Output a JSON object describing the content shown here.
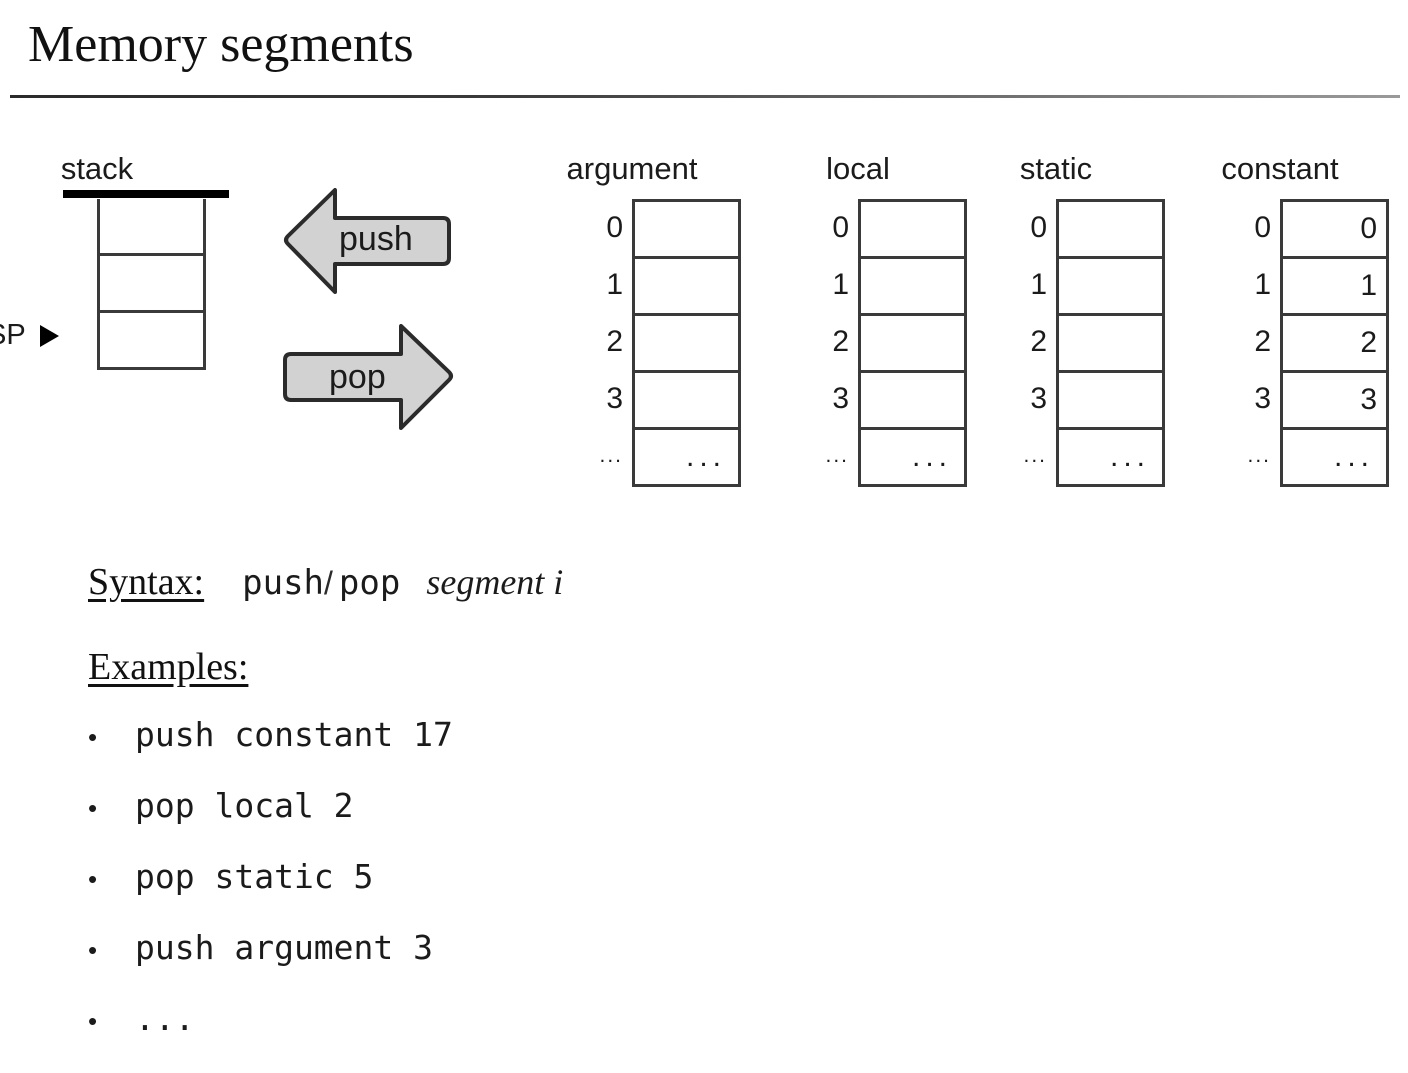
{
  "slide": {
    "title": "Memory segments"
  },
  "stack": {
    "label": "stack",
    "pointer_label": "SP",
    "pointer_icon": "right-triangle-arrow-icon",
    "pointer_at_cell": 2,
    "cells": [
      "",
      "",
      ""
    ]
  },
  "operations": [
    {
      "name": "push",
      "label": "push",
      "direction": "left",
      "icon": "left-arrow-shape-icon"
    },
    {
      "name": "pop",
      "label": "pop",
      "direction": "right",
      "icon": "right-arrow-shape-icon"
    }
  ],
  "segments": [
    {
      "name": "argument",
      "label": "argument",
      "indices": [
        "0",
        "1",
        "2",
        "3",
        "..."
      ],
      "values": [
        "",
        "",
        "",
        "",
        "..."
      ]
    },
    {
      "name": "local",
      "label": "local",
      "indices": [
        "0",
        "1",
        "2",
        "3",
        "..."
      ],
      "values": [
        "",
        "",
        "",
        "",
        "..."
      ]
    },
    {
      "name": "static",
      "label": "static",
      "indices": [
        "0",
        "1",
        "2",
        "3",
        "..."
      ],
      "values": [
        "",
        "",
        "",
        "",
        "..."
      ]
    },
    {
      "name": "constant",
      "label": "constant",
      "indices": [
        "0",
        "1",
        "2",
        "3",
        "..."
      ],
      "values": [
        "0",
        "1",
        "2",
        "3",
        "..."
      ]
    }
  ],
  "syntax": {
    "label": "Syntax:",
    "command": "push",
    "separator": "/",
    "command_alt": "pop",
    "operand": "segment i"
  },
  "examples": {
    "label": "Examples:",
    "items": [
      "push constant 17",
      "pop local 2",
      "pop static 5",
      "push argument 3",
      "..."
    ],
    "bullet_glyph": "•"
  },
  "colors": {
    "ink": "#1b1b1b",
    "box_border": "#3a3a3a",
    "arrow_fill": "#d2d2d2",
    "arrow_stroke": "#2b2b2b",
    "stack_top_bar": "#000000",
    "rule": "#3a3a3a",
    "background": "#ffffff"
  }
}
